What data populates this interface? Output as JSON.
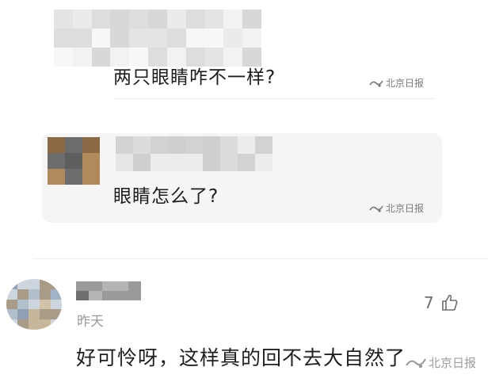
{
  "comment_1": {
    "text": "两只眼睛咋不一样?"
  },
  "comment_2": {
    "text": "眼睛怎么了?"
  },
  "comment_3": {
    "time": "昨天",
    "like_count": "7",
    "text": "好可怜呀，这样真的回不去大自然了"
  },
  "watermark": {
    "text": "北京日报"
  },
  "icons": {
    "like": "thumbs-up-icon",
    "watermark": "newspaper-logo-icon"
  }
}
